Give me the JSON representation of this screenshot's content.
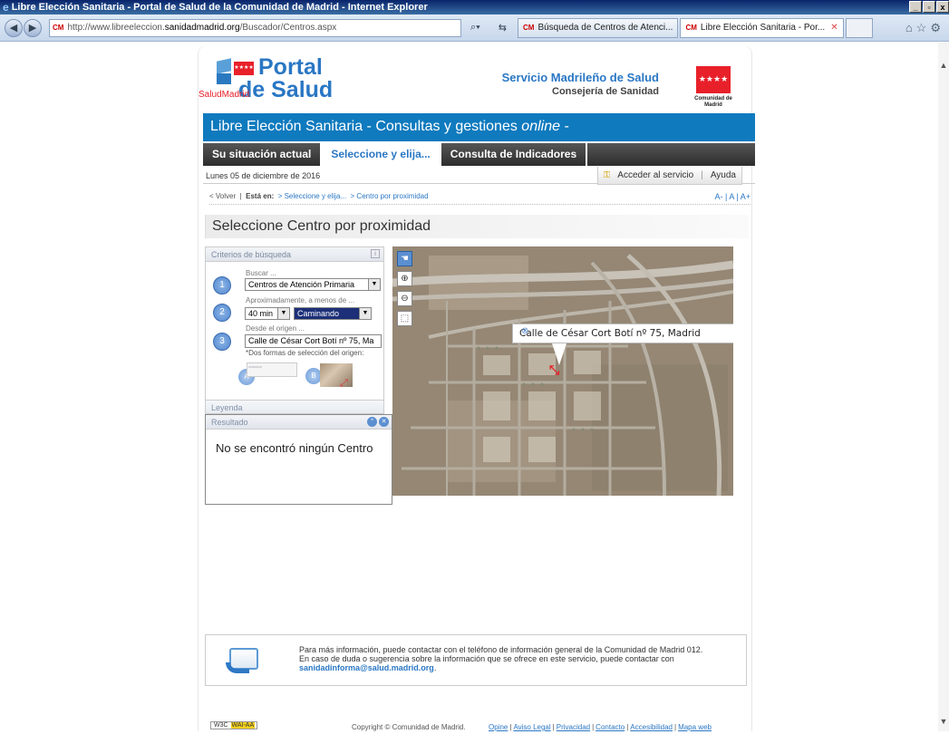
{
  "browser": {
    "title": "Libre Elección Sanitaria - Portal de Salud de la Comunidad de Madrid - Internet Explorer",
    "url_prefix": "http://www.libreeleccion.",
    "url_domain": "sanidadmadrid.org",
    "url_path": "/Buscador/Centros.aspx",
    "tabs": [
      {
        "label": "Búsqueda de Centros de Atenci...",
        "active": false
      },
      {
        "label": "Libre Elección Sanitaria - Por...",
        "active": true
      }
    ],
    "cm_badge": "CM"
  },
  "header": {
    "logo_portal": "Portal",
    "logo_salud": "de Salud",
    "logo_small": "SaludMadrid",
    "org_title": "Servicio Madrileño de Salud",
    "org_subtitle": "Consejería de Sanidad",
    "cm_logo_text": "Comunidad de Madrid",
    "cm_flag": "★★★★"
  },
  "banner": {
    "text": "Libre Elección Sanitaria - Consultas y gestiones ",
    "italic": "online",
    "suffix": " -"
  },
  "nav_tabs": [
    {
      "label": "Su situación actual",
      "selected": false
    },
    {
      "label": "Seleccione y elija...",
      "selected": true
    },
    {
      "label": "Consulta de Indicadores",
      "selected": false
    }
  ],
  "date": "Lunes 05 de diciembre de 2016",
  "access": {
    "login": "Acceder al servicio",
    "help": "Ayuda"
  },
  "breadcrumb": {
    "back": "< Volver",
    "sep": "|",
    "here_label": "Está en:",
    "items": [
      "> Seleccione y elija...",
      "> Centro por proximidad"
    ],
    "font_sizes": "A- | A | A+"
  },
  "page_title": "Seleccione Centro por proximidad",
  "criteria": {
    "header": "Criterios de búsqueda",
    "step1_label": "Buscar ...",
    "step1_value": "Centros de Atención Primaria",
    "step2_label": "Aproximadamente, a menos de ...",
    "step2_time": "40 min",
    "step2_mode": "Caminando",
    "step3_label": "Desde el origen ...",
    "step3_value": "Calle de César Cort Botí nº 75, Ma",
    "hint": "*Dos formas de selección del origen:",
    "option_a": "A",
    "option_b": "B"
  },
  "legend_label": "Leyenda",
  "result": {
    "header": "Resultado",
    "message": "No se encontró ningún Centro"
  },
  "map": {
    "popup_text": "Calle de César Cort Botí nº 75, Madrid"
  },
  "info": {
    "line1": "Para más información, puede contactar con el teléfono de información general de la Comunidad de Madrid 012.",
    "line2": "En caso de duda o sugerencia sobre la información que se ofrece en este servicio, puede contactar con",
    "email": "sanidadinforma@salud.madrid.org",
    "email_suffix": "."
  },
  "footer": {
    "wai_prefix": "W3C",
    "wai_badge": "WAI-AA",
    "copyright": "Copyright © Comunidad de Madrid.",
    "links": [
      "Opine",
      "Aviso Legal",
      "Privacidad",
      "Contacto",
      "Accesibilidad",
      "Mapa web"
    ]
  },
  "colors": {
    "brand_blue": "#0f7abe",
    "cm_red": "#e8202a",
    "tab_dark": "#2d2d2d"
  }
}
